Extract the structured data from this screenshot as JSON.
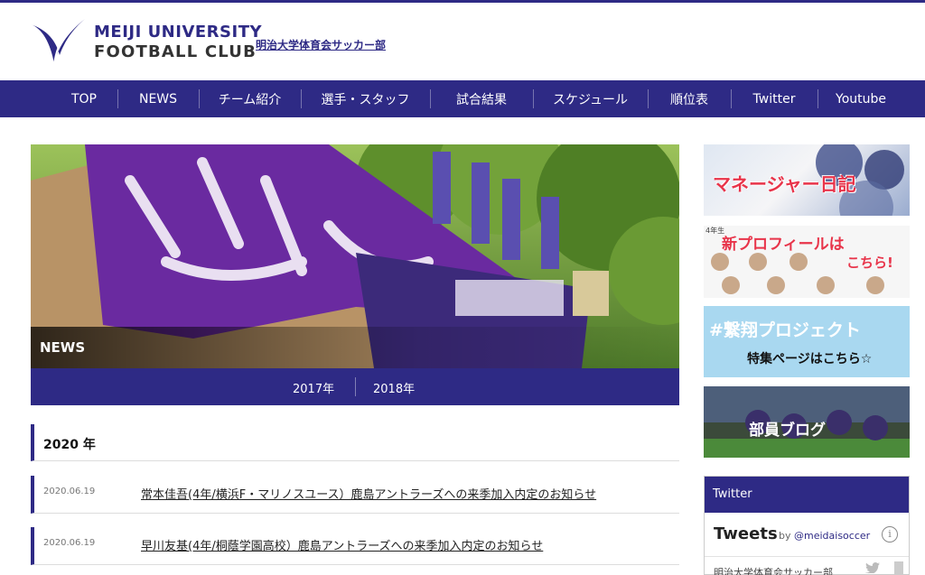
{
  "header": {
    "logo_line1": "MEIJI UNIVERSITY",
    "logo_line2": "FOOTBALL CLUB",
    "jp_link": "明治大学体育会サッカー部"
  },
  "nav": {
    "items": [
      {
        "label": "TOP"
      },
      {
        "label": "NEWS"
      },
      {
        "label": "チーム紹介"
      },
      {
        "label": "選手・スタッフ"
      },
      {
        "label": "試合結果"
      },
      {
        "label": "スケジュール"
      },
      {
        "label": "順位表"
      },
      {
        "label": "Twitter"
      },
      {
        "label": "Youtube"
      }
    ]
  },
  "hero": {
    "label": "NEWS"
  },
  "years": {
    "tabs": [
      "2017年",
      "2018年"
    ]
  },
  "news": {
    "section_title": "2020 年",
    "items": [
      {
        "date": "2020.06.19",
        "title": "常本佳吾(4年/横浜F・マリノスユース）鹿島アントラーズへの来季加入内定のお知らせ"
      },
      {
        "date": "2020.06.19",
        "title": "早川友基(4年/桐蔭学園高校）鹿島アントラーズへの来季加入内定のお知らせ"
      }
    ]
  },
  "sidebar": {
    "banner1_text": "マネージャー日記",
    "banner2_tag": "4年生",
    "banner2_line1": "新プロフィールは",
    "banner2_line2": "こちら!",
    "banner3_line1": "#繋翔プロジェクト",
    "banner3_line2": "特集ページはこちら☆",
    "banner4_text": "部員ブログ"
  },
  "twitter": {
    "header": "Twitter",
    "title": "Tweets",
    "by": "by",
    "handle": "@meidaisoccer",
    "info": "i",
    "user": "明治大学体育会サッカー部"
  },
  "colors": {
    "brand": "#2e2a85",
    "banner_red": "#e8344a",
    "banner_blue": "#a9d8f0"
  }
}
